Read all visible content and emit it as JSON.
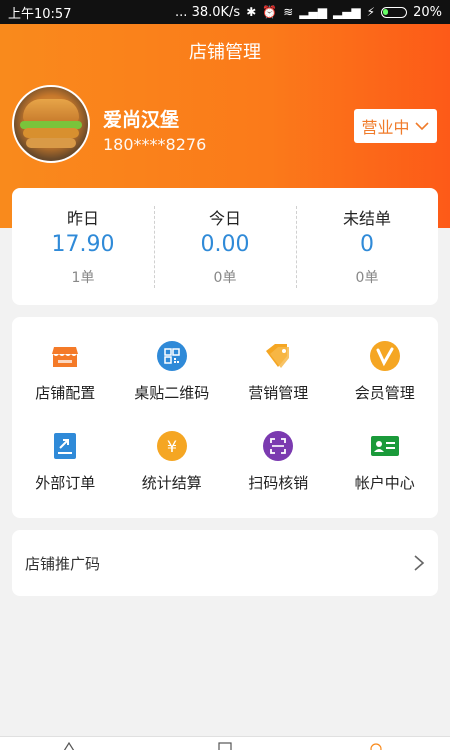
{
  "status_bar": {
    "time": "上午10:57",
    "network_speed": "... 38.0K/s",
    "battery": "20%",
    "icons": [
      "bluetooth-icon",
      "alarm-icon",
      "wifi-icon",
      "signal-icon",
      "hd-signal-icon",
      "charging-icon",
      "battery-icon"
    ]
  },
  "header": {
    "title": "店铺管理",
    "shop_name": "爱尚汉堡",
    "phone": "180****8276",
    "status_label": "营业中"
  },
  "stats": [
    {
      "label": "昨日",
      "value": "17.90",
      "sub": "1单"
    },
    {
      "label": "今日",
      "value": "0.00",
      "sub": "0单"
    },
    {
      "label": "未结单",
      "value": "0",
      "sub": "0单"
    }
  ],
  "functions": [
    {
      "label": "店铺配置",
      "icon": "store-icon",
      "color": "#f47a28"
    },
    {
      "label": "桌贴二维码",
      "icon": "qrcode-icon",
      "color": "#2f8ad8"
    },
    {
      "label": "营销管理",
      "icon": "tag-icon",
      "color": "#f5a623"
    },
    {
      "label": "会员管理",
      "icon": "vip-icon",
      "color": "#f5a623"
    },
    {
      "label": "外部订单",
      "icon": "external-order-icon",
      "color": "#2f8ad8"
    },
    {
      "label": "统计结算",
      "icon": "yuan-icon",
      "color": "#f5a623"
    },
    {
      "label": "扫码核销",
      "icon": "scan-icon",
      "color": "#7b3ab0"
    },
    {
      "label": "帐户中心",
      "icon": "account-card-icon",
      "color": "#1a9a3a"
    }
  ],
  "promo": {
    "label": "店铺推广码"
  },
  "colors": {
    "accent": "#f98a1c",
    "value_blue": "#2f8ad8"
  }
}
